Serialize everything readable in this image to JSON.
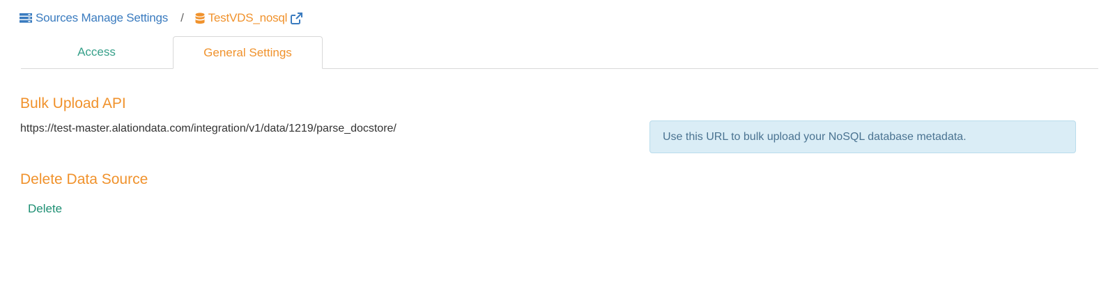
{
  "breadcrumb": {
    "sources_label": "Sources Manage Settings",
    "separator": "/",
    "current_label": "TestVDS_nosql",
    "sources_icon": "server-list-icon",
    "current_icon": "database-icon",
    "link_icon": "external-link-icon"
  },
  "tabs": [
    {
      "label": "Access",
      "active": false
    },
    {
      "label": "General Settings",
      "active": true
    }
  ],
  "bulk_upload": {
    "title": "Bulk Upload API",
    "url": "https://test-master.alationdata.com/integration/v1/data/1219/parse_docstore/",
    "info": "Use this URL to bulk upload your NoSQL database metadata."
  },
  "delete_section": {
    "title": "Delete Data Source",
    "delete_label": "Delete"
  },
  "colors": {
    "accent_orange": "#f0922c",
    "link_blue": "#3a7bbf",
    "tab_teal": "#37a08a",
    "delete_green": "#1e8f73",
    "info_bg": "#daedf6"
  }
}
